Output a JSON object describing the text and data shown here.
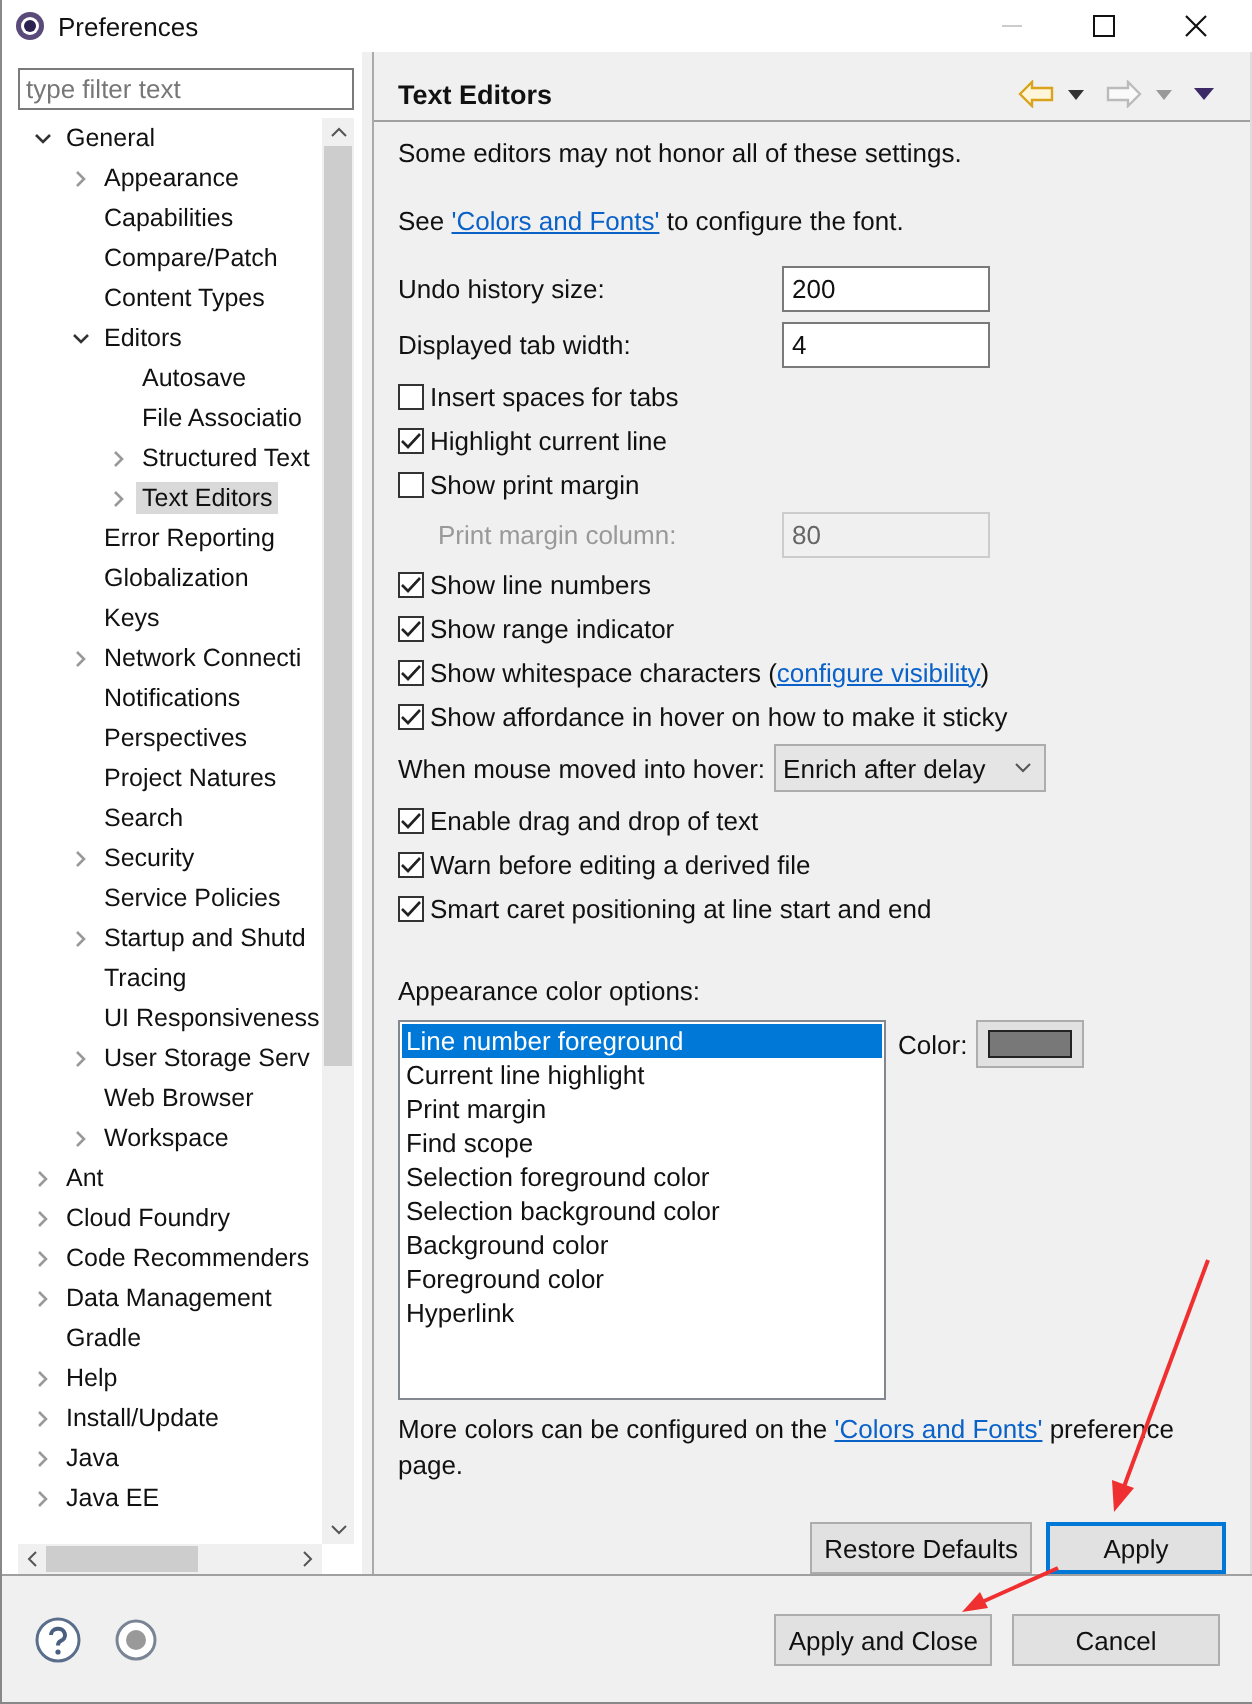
{
  "window": {
    "title": "Preferences"
  },
  "filter": {
    "placeholder": "type filter text"
  },
  "tree": [
    {
      "label": "General",
      "expanded": true,
      "selected": false,
      "children": [
        {
          "label": "Appearance",
          "expanded": false,
          "selected": false
        },
        {
          "label": "Capabilities",
          "selected": false
        },
        {
          "label": "Compare/Patch",
          "selected": false
        },
        {
          "label": "Content Types",
          "selected": false
        },
        {
          "label": "Editors",
          "expanded": true,
          "selected": false,
          "children": [
            {
              "label": "Autosave",
              "selected": false
            },
            {
              "label": "File Associatio",
              "selected": false
            },
            {
              "label": "Structured Text",
              "expanded": false,
              "selected": false
            },
            {
              "label": "Text Editors",
              "expanded": false,
              "selected": true
            }
          ]
        },
        {
          "label": "Error Reporting",
          "selected": false
        },
        {
          "label": "Globalization",
          "selected": false
        },
        {
          "label": "Keys",
          "selected": false
        },
        {
          "label": "Network Connecti",
          "expanded": false,
          "selected": false
        },
        {
          "label": "Notifications",
          "selected": false
        },
        {
          "label": "Perspectives",
          "selected": false
        },
        {
          "label": "Project Natures",
          "selected": false
        },
        {
          "label": "Search",
          "selected": false
        },
        {
          "label": "Security",
          "expanded": false,
          "selected": false
        },
        {
          "label": "Service Policies",
          "selected": false
        },
        {
          "label": "Startup and Shutd",
          "expanded": false,
          "selected": false
        },
        {
          "label": "Tracing",
          "selected": false
        },
        {
          "label": "UI Responsiveness",
          "selected": false
        },
        {
          "label": "User Storage Serv",
          "expanded": false,
          "selected": false
        },
        {
          "label": "Web Browser",
          "selected": false
        },
        {
          "label": "Workspace",
          "expanded": false,
          "selected": false
        }
      ]
    },
    {
      "label": "Ant",
      "expanded": false,
      "selected": false
    },
    {
      "label": "Cloud Foundry",
      "expanded": false,
      "selected": false
    },
    {
      "label": "Code Recommenders",
      "expanded": false,
      "selected": false
    },
    {
      "label": "Data Management",
      "expanded": false,
      "selected": false
    },
    {
      "label": "Gradle",
      "selected": false
    },
    {
      "label": "Help",
      "expanded": false,
      "selected": false
    },
    {
      "label": "Install/Update",
      "expanded": false,
      "selected": false
    },
    {
      "label": "Java",
      "expanded": false,
      "selected": false
    },
    {
      "label": "Java EE",
      "expanded": false,
      "selected": false
    }
  ],
  "page": {
    "title": "Text Editors",
    "intro": "Some editors may not honor all of these settings.",
    "font_note": {
      "before": "See ",
      "link": "'Colors and Fonts'",
      "after": " to configure the font."
    },
    "fields": [
      {
        "label": "Undo history size:",
        "value": "200"
      },
      {
        "label": "Displayed tab width:",
        "value": "4"
      }
    ],
    "settings": [
      {
        "kind": "checkbox",
        "label": "Insert spaces for tabs",
        "checked": false
      },
      {
        "kind": "checkbox",
        "label": "Highlight current line",
        "checked": true
      },
      {
        "kind": "checkbox",
        "label": "Show print margin",
        "checked": false
      },
      {
        "kind": "field",
        "label": "Print margin column:",
        "value": "80",
        "disabled": true
      },
      {
        "kind": "checkbox",
        "label": "Show line numbers",
        "checked": true
      },
      {
        "kind": "checkbox",
        "label": "Show range indicator",
        "checked": true
      },
      {
        "kind": "checkbox",
        "label": "Show whitespace characters (",
        "link": "configure visibility",
        "after": ")",
        "checked": true
      },
      {
        "kind": "checkbox",
        "label": "Show affordance in hover on how to make it sticky",
        "checked": true
      },
      {
        "kind": "combo",
        "label": "When mouse moved into hover:",
        "value": "Enrich after delay"
      },
      {
        "kind": "checkbox",
        "label": "Enable drag and drop of text",
        "checked": true
      },
      {
        "kind": "checkbox",
        "label": "Warn before editing a derived file",
        "checked": true
      },
      {
        "kind": "checkbox",
        "label": "Smart caret positioning at line start and end",
        "checked": true
      }
    ],
    "colors_label": "Appearance color options:",
    "color_items": [
      {
        "label": "Line number foreground",
        "selected": true
      },
      {
        "label": "Current line highlight",
        "selected": false
      },
      {
        "label": "Print margin",
        "selected": false
      },
      {
        "label": "Find scope",
        "selected": false
      },
      {
        "label": "Selection foreground color",
        "selected": false
      },
      {
        "label": "Selection background color",
        "selected": false
      },
      {
        "label": "Background color",
        "selected": false
      },
      {
        "label": "Foreground color",
        "selected": false
      },
      {
        "label": "Hyperlink",
        "selected": false
      }
    ],
    "color_label": "Color:",
    "more_note": {
      "before": "More colors can be configured on the ",
      "link": "'Colors and Fonts'",
      "after": " preference page."
    },
    "buttons": [
      "Restore Defaults",
      "Apply"
    ]
  },
  "footer_buttons": [
    "Apply and Close",
    "Cancel"
  ]
}
